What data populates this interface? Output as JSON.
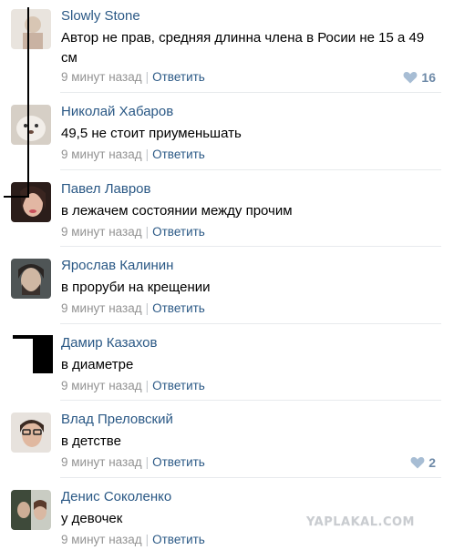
{
  "comments": [
    {
      "author": "Slowly Stone",
      "text": "Автор не прав, средняя длинна члена в Росии не 15 а 49 см",
      "time": "9 минут назад",
      "reply": "Ответить",
      "likes": "16"
    },
    {
      "author": "Николай Хабаров",
      "text": "49,5 не стоит приуменьшать",
      "time": "9 минут назад",
      "reply": "Ответить"
    },
    {
      "author": "Павел Лавров",
      "text": "в лежачем состоянии между прочим",
      "time": "9 минут назад",
      "reply": "Ответить"
    },
    {
      "author": "Ярослав Калинин",
      "text": "в проруби на крещении",
      "time": "9 минут назад",
      "reply": "Ответить"
    },
    {
      "author": "Дамир Казахов",
      "text": "в диаметре",
      "time": "9 минут назад",
      "reply": "Ответить"
    },
    {
      "author": "Влад Преловский",
      "text": "в детстве",
      "time": "9 минут назад",
      "reply": "Ответить",
      "likes": "2"
    },
    {
      "author": "Денис Соколенко",
      "text": "у девочек",
      "time": "9 минут назад",
      "reply": "Ответить"
    }
  ],
  "separator": "|",
  "watermark": "YAPLAKAL.COM",
  "colors": {
    "link": "#2a5885",
    "meta": "#939393",
    "like": "#6e8aa8",
    "heart": "#a7bdd4"
  },
  "icons": {
    "like": "heart-icon"
  }
}
